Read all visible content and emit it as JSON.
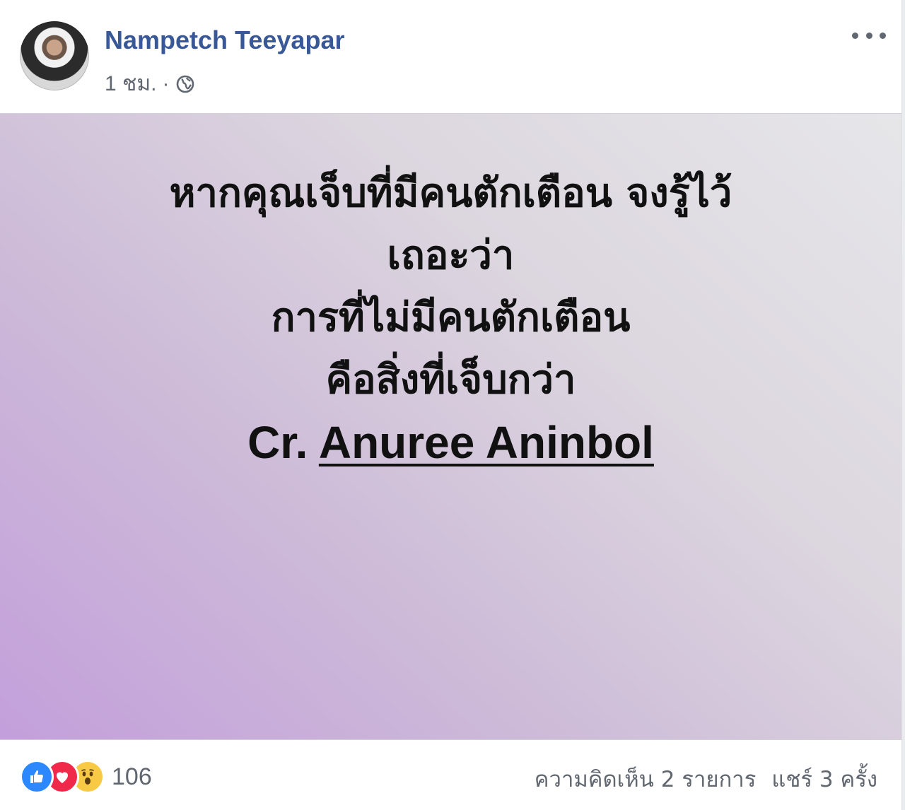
{
  "post": {
    "author": "Nampetch Teeyapar",
    "timestamp": "1 ชม.",
    "separator": "·",
    "privacy_icon": "globe-icon",
    "more_icon": "more-options-icon"
  },
  "content": {
    "lines": [
      "หากคุณเจ็บที่มีคนตักเตือน จงรู้ไว้",
      "เถอะว่า",
      "การที่ไม่มีคนตักเตือน",
      "คือสิ่งที่เจ็บกว่า"
    ],
    "credit_prefix": "Cr.",
    "credit_name": "Anuree Aninbol"
  },
  "footer": {
    "reaction_icons": [
      "like-icon",
      "love-icon",
      "wow-icon"
    ],
    "reaction_count": "106",
    "comments": "ความคิดเห็น 2 รายการ",
    "shares": "แชร์ 3 ครั้ง"
  },
  "colors": {
    "author_link": "#385898",
    "meta_text": "#616770",
    "like": "#2d88ff",
    "love": "#f0284a",
    "wow": "#f7c945"
  }
}
